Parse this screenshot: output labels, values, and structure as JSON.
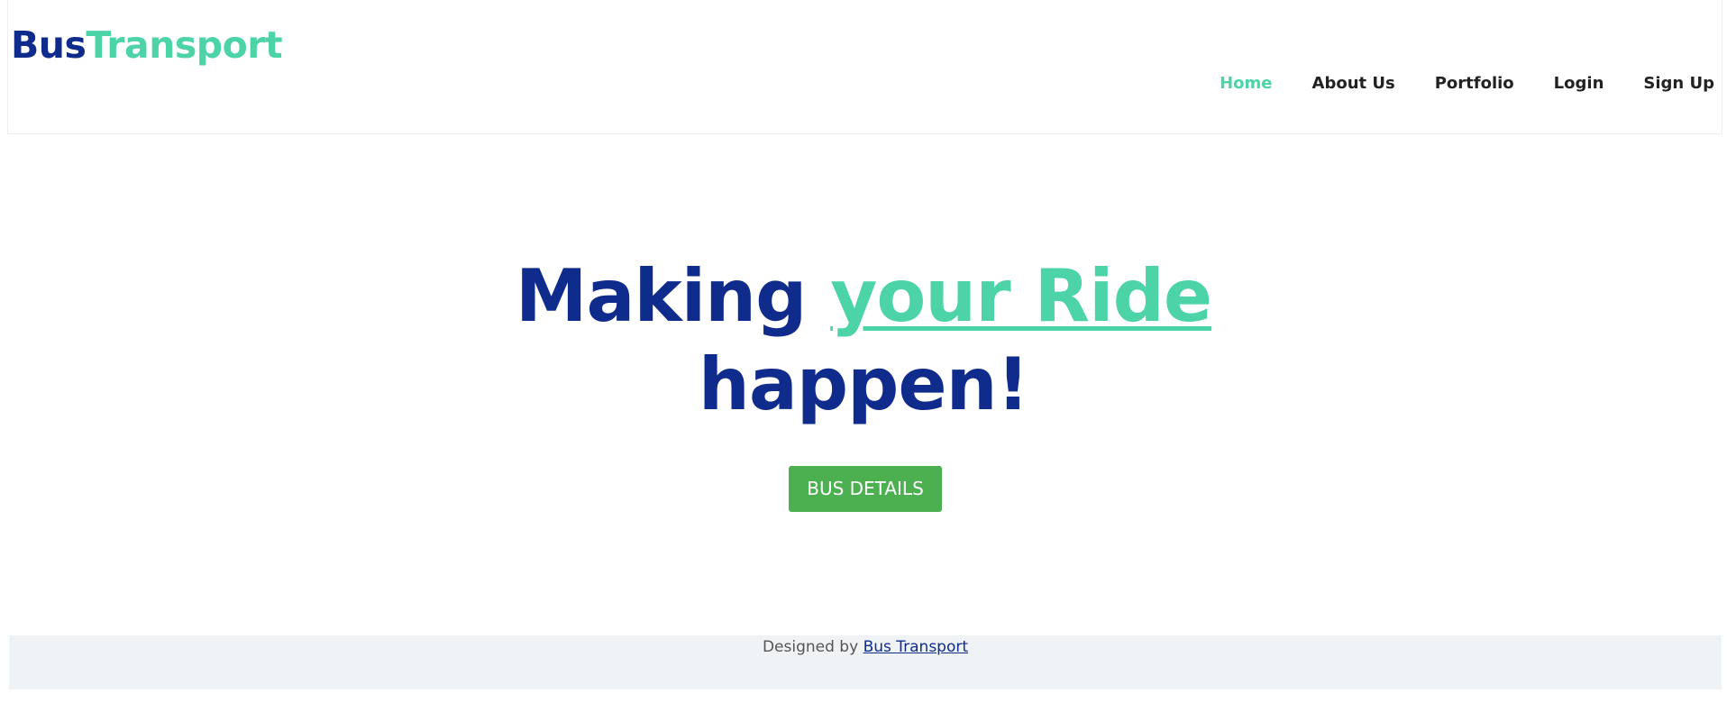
{
  "header": {
    "logo_part1": "Bus",
    "logo_part2": "Transport",
    "nav": [
      {
        "label": "Home",
        "active": true
      },
      {
        "label": "About Us",
        "active": false
      },
      {
        "label": "Portfolio",
        "active": false
      },
      {
        "label": "Login",
        "active": false
      },
      {
        "label": "Sign Up",
        "active": false
      }
    ]
  },
  "hero": {
    "title_part1": "Making ",
    "title_accent": "your Ride",
    "title_part2": "happen!",
    "button_label": "BUS DETAILS"
  },
  "footer": {
    "prefix": "Designed by ",
    "link_text": "Bus Transport"
  },
  "colors": {
    "brand_dark": "#0f2b8c",
    "brand_accent": "#4cd3a8",
    "button_green": "#4caf50",
    "footer_bg": "#eff3f6"
  }
}
